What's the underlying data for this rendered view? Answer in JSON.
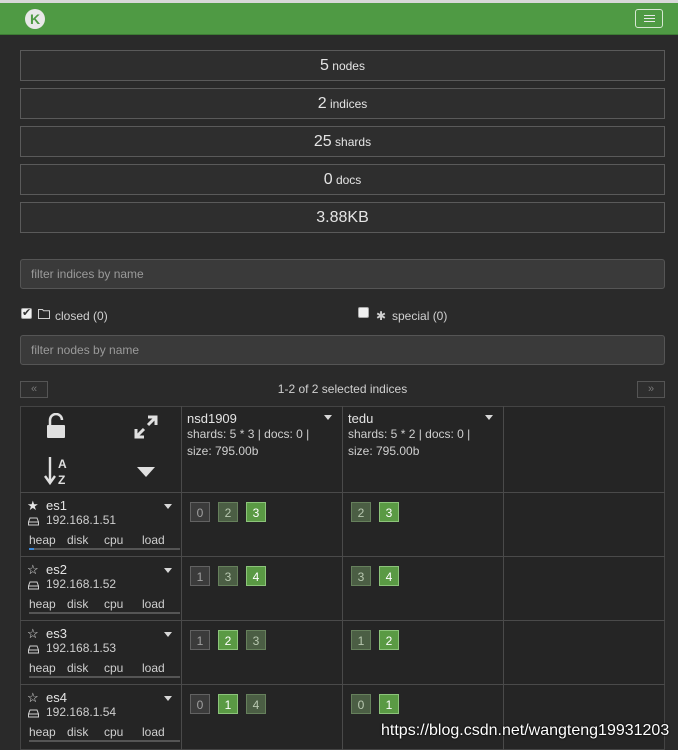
{
  "app": {
    "logo_letter": "K"
  },
  "stats": [
    {
      "num": "5",
      "unit": "nodes"
    },
    {
      "num": "2",
      "unit": "indices"
    },
    {
      "num": "25",
      "unit": "shards"
    },
    {
      "num": "0",
      "unit": "docs"
    },
    {
      "num": "3.88KB",
      "unit": ""
    }
  ],
  "filters": {
    "indices_placeholder": "filter indices by name",
    "nodes_placeholder": "filter nodes by name",
    "closed_label": "closed (0)",
    "closed_checked": true,
    "special_label": "special (0)",
    "special_checked": false
  },
  "pager": {
    "prev": "«",
    "next": "»",
    "info": "1-2 of 2 selected indices"
  },
  "indices": [
    {
      "name": "nsd1909",
      "shards_line": "shards: 5 * 3 | docs: 0 |",
      "size_line": "size: 795.00b"
    },
    {
      "name": "tedu",
      "shards_line": "shards: 5 * 2 | docs: 0 |",
      "size_line": "size: 795.00b"
    }
  ],
  "metric_labels": [
    "heap",
    "disk",
    "cpu",
    "load"
  ],
  "nodes": [
    {
      "name": "es1",
      "ip": "192.168.1.51",
      "master": true,
      "heap_pct": 12,
      "shards": [
        [
          {
            "n": "0",
            "kind": "replica"
          },
          {
            "n": "2",
            "kind": "replica"
          },
          {
            "n": "3",
            "kind": "primary"
          }
        ],
        [
          {
            "n": "2",
            "kind": "replica"
          },
          {
            "n": "3",
            "kind": "primary"
          }
        ]
      ]
    },
    {
      "name": "es2",
      "ip": "192.168.1.52",
      "master": false,
      "heap_pct": 0,
      "shards": [
        [
          {
            "n": "1",
            "kind": "replica"
          },
          {
            "n": "3",
            "kind": "replica"
          },
          {
            "n": "4",
            "kind": "primary"
          }
        ],
        [
          {
            "n": "3",
            "kind": "replica"
          },
          {
            "n": "4",
            "kind": "primary"
          }
        ]
      ]
    },
    {
      "name": "es3",
      "ip": "192.168.1.53",
      "master": false,
      "heap_pct": 0,
      "shards": [
        [
          {
            "n": "1",
            "kind": "replica"
          },
          {
            "n": "2",
            "kind": "primary"
          },
          {
            "n": "3",
            "kind": "replica"
          }
        ],
        [
          {
            "n": "1",
            "kind": "replica"
          },
          {
            "n": "2",
            "kind": "primary"
          }
        ]
      ]
    },
    {
      "name": "es4",
      "ip": "192.168.1.54",
      "master": false,
      "heap_pct": 0,
      "shards": [
        [
          {
            "n": "0",
            "kind": "replica"
          },
          {
            "n": "1",
            "kind": "primary"
          },
          {
            "n": "4",
            "kind": "replica"
          }
        ],
        [
          {
            "n": "0",
            "kind": "replica"
          },
          {
            "n": "1",
            "kind": "primary"
          }
        ]
      ]
    }
  ],
  "watermark": "https://blog.csdn.net/wangteng19931203"
}
